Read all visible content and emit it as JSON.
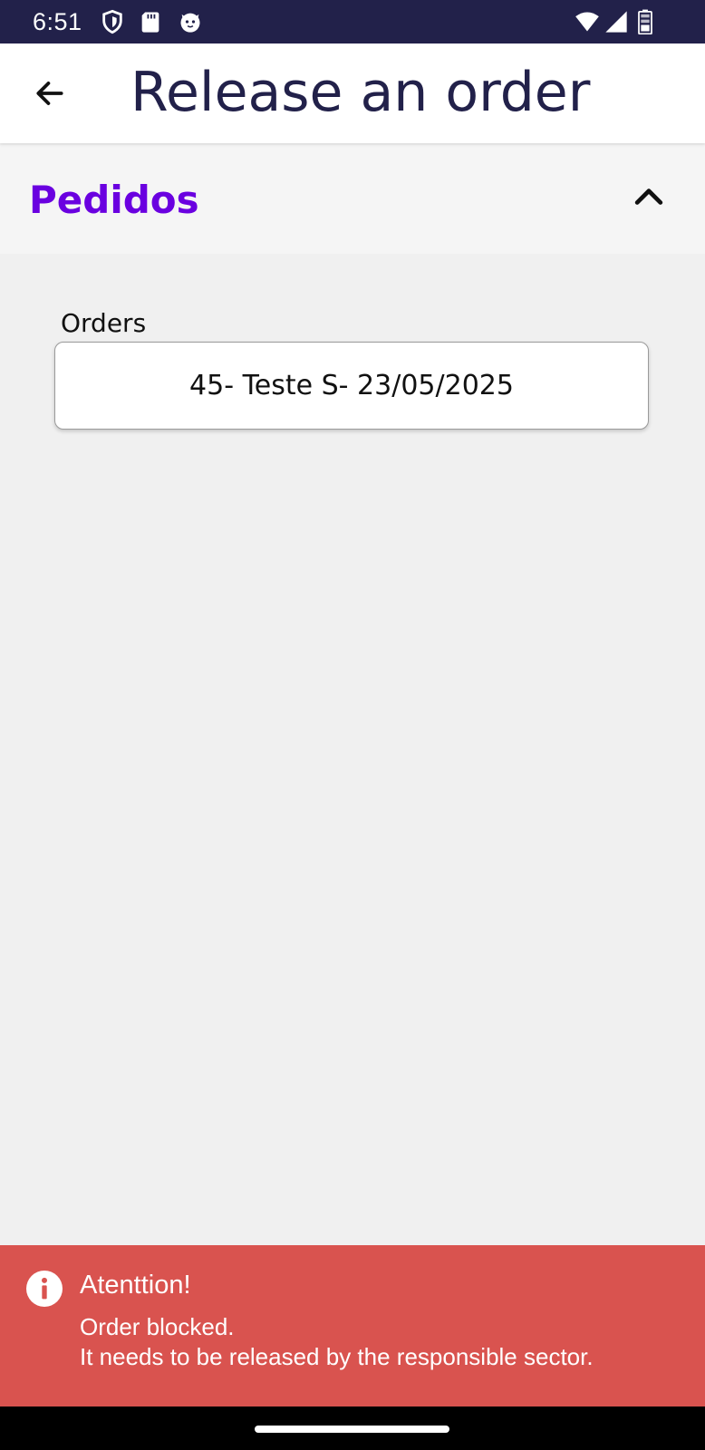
{
  "status_bar": {
    "time": "6:51",
    "left_icons": [
      "shield-icon",
      "sd-card-icon",
      "cat-face-icon"
    ],
    "right_icons": [
      "wifi-icon",
      "signal-icon",
      "battery-icon"
    ]
  },
  "app_bar": {
    "back_icon": "back-arrow-icon",
    "title": "Release an order"
  },
  "section": {
    "title": "Pedidos",
    "expanded": true,
    "toggle_icon": "chevron-up-icon"
  },
  "orders_field": {
    "label": "Orders",
    "selected_value": "45- Teste S- 23/05/2025"
  },
  "alert": {
    "icon": "info-icon",
    "title": "Atenttion!",
    "message": "Order blocked.\nIt needs to be released by the responsible sector.",
    "color": "#d9534f"
  },
  "colors": {
    "status_bar": "#22214a",
    "title_text": "#22214a",
    "section_title": "#6a00e0",
    "background": "#f0f0f0"
  }
}
